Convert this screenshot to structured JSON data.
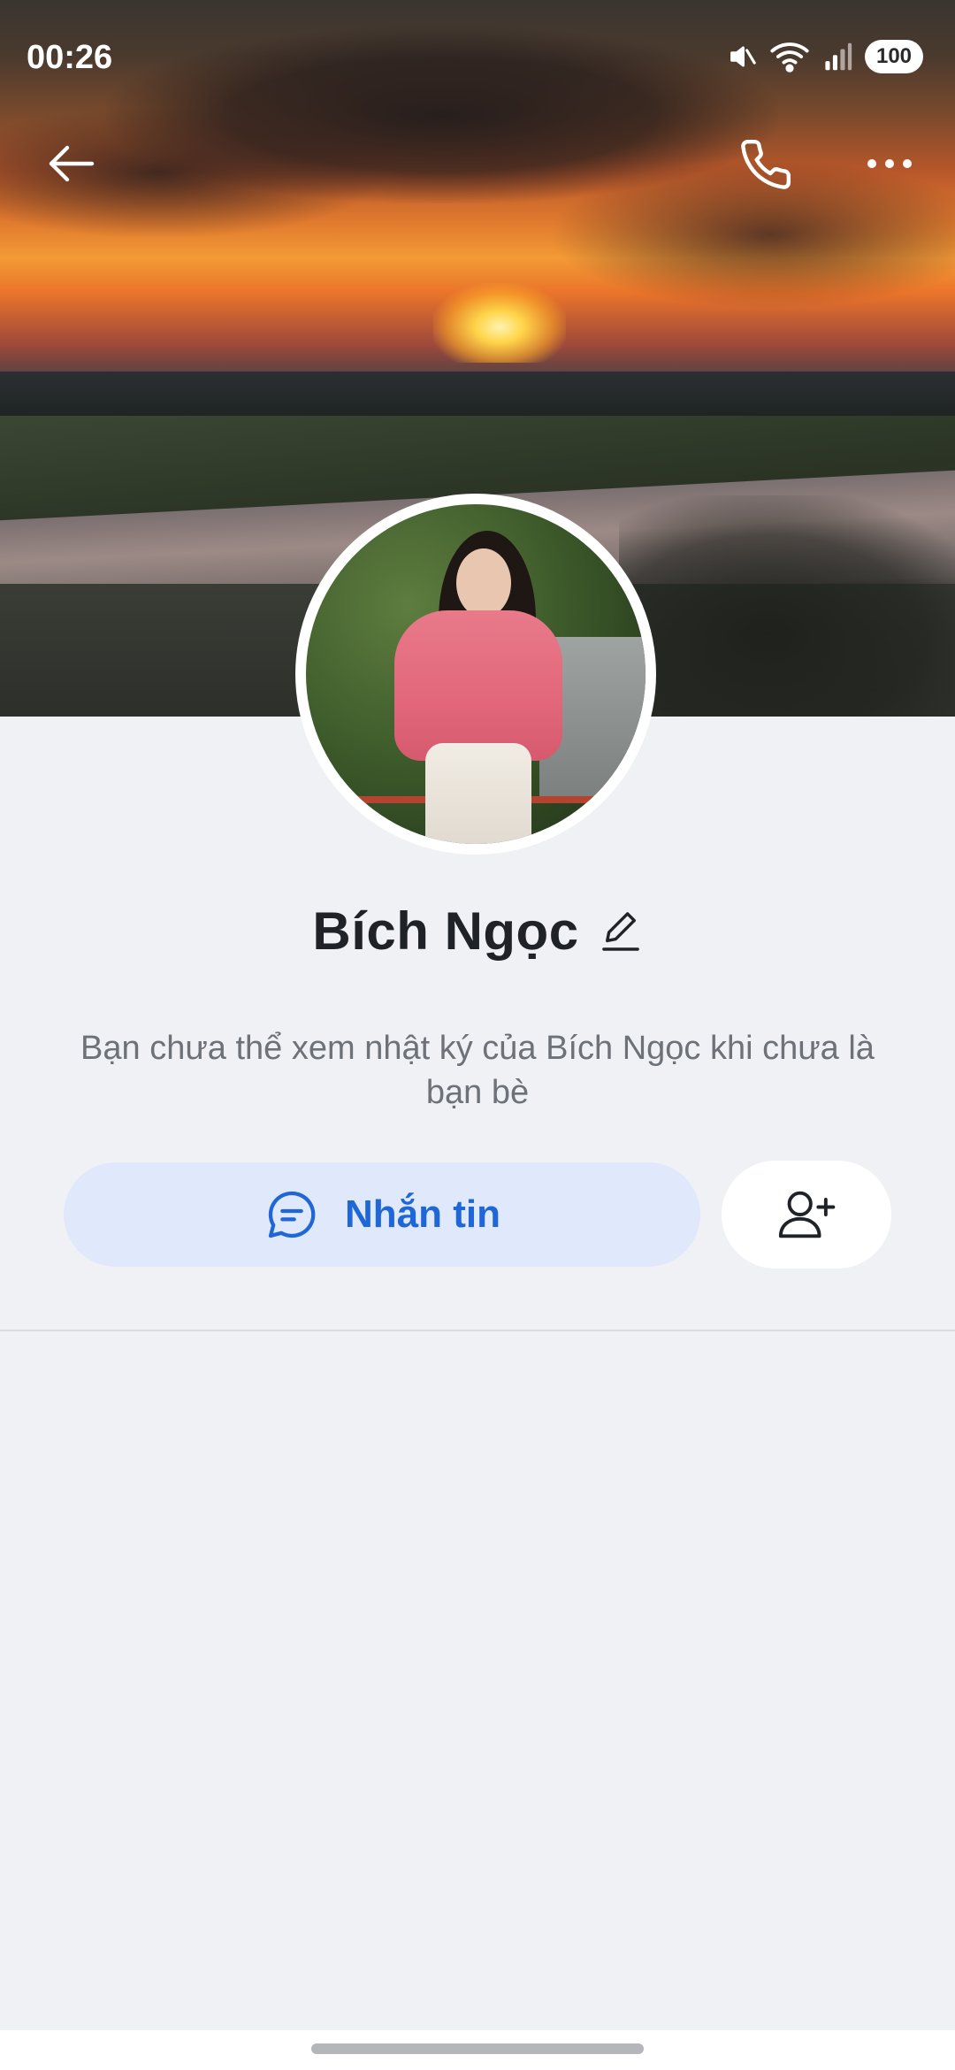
{
  "status_bar": {
    "time": "00:26",
    "battery": "100",
    "icons": [
      "mute-icon",
      "wifi-icon",
      "signal-icon",
      "battery-icon"
    ]
  },
  "top_bar": {
    "back_icon": "arrow-left-icon",
    "call_icon": "phone-icon",
    "more_icon": "more-horizontal-icon"
  },
  "profile": {
    "name": "Bích Ngọc",
    "edit_icon": "pencil-icon",
    "privacy_note": "Bạn chưa thể xem nhật ký của Bích Ngọc khi chưa là bạn bè"
  },
  "actions": {
    "message_label": "Nhắn tin",
    "message_icon": "chat-bubble-icon",
    "add_friend_icon": "add-user-icon"
  },
  "colors": {
    "accent": "#1f66d6",
    "message_button_bg": "#dfe9fb",
    "page_bg": "#f0f1f5"
  }
}
